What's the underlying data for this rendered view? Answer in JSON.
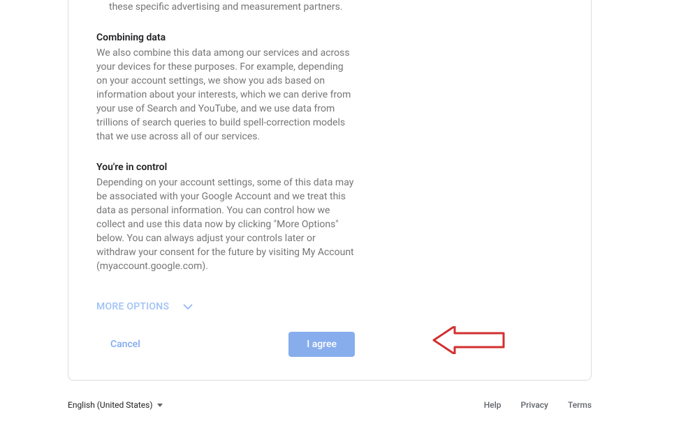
{
  "content": {
    "partial_line": "these specific advertising and measurement partners.",
    "sections": [
      {
        "heading": "Combining data",
        "body": "We also combine this data among our services and across your devices for these purposes. For example, depending on your account settings, we show you ads based on information about your interests, which we can derive from your use of Search and YouTube, and we use data from trillions of search queries to build spell-correction models that we use across all of our services."
      },
      {
        "heading": "You're in control",
        "body": "Depending on your account settings, some of this data may be associated with your Google Account and we treat this data as personal information. You can control how we collect and use this data now by clicking \"More Options\" below. You can always adjust your controls later or withdraw your consent for the future by visiting My Account (myaccount.google.com)."
      }
    ]
  },
  "more_options_label": "MORE OPTIONS",
  "buttons": {
    "cancel": "Cancel",
    "agree": "I agree"
  },
  "footer": {
    "language": "English (United States)",
    "links": {
      "help": "Help",
      "privacy": "Privacy",
      "terms": "Terms"
    }
  }
}
